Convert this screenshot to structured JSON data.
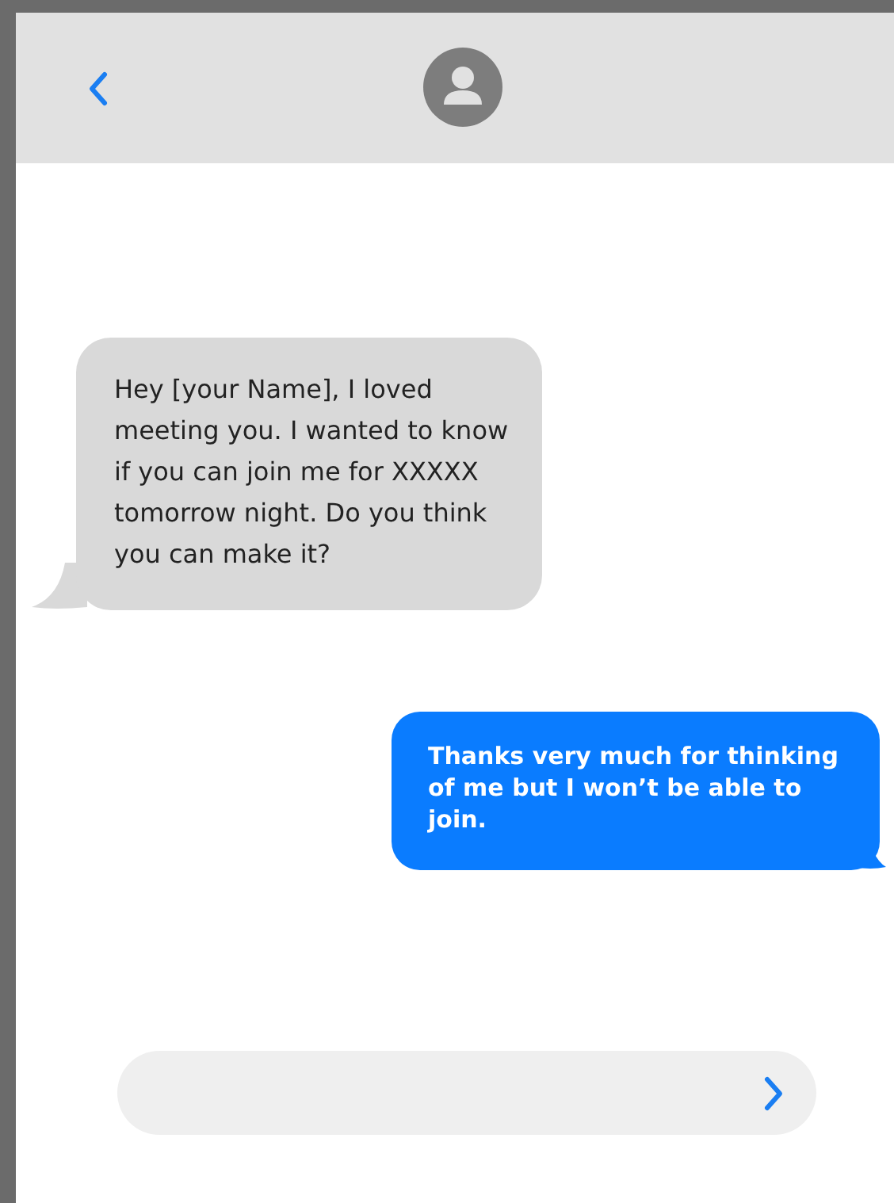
{
  "messages": [
    {
      "kind": "incoming",
      "text": "Hey [your Name], I loved meeting you. I wanted to know if you can join me for XXXXX tomorrow night. Do you think you can make it?"
    },
    {
      "kind": "outgoing",
      "text": "Thanks very much for thinking of me but I won’t be able to join."
    }
  ]
}
